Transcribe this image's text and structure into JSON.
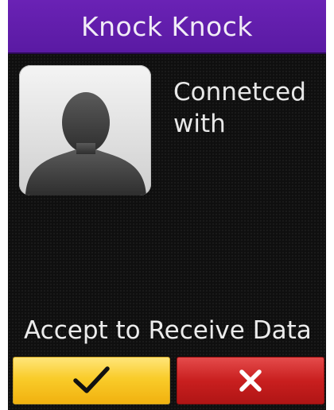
{
  "header": {
    "title": "Knock Knock"
  },
  "contact": {
    "status_line1": "Connetced",
    "status_line2": "with"
  },
  "prompt": {
    "text": "Accept to Receive Data"
  },
  "actions": {
    "accept_icon": "checkmark-icon",
    "reject_icon": "close-icon"
  },
  "colors": {
    "titlebar": "#5a1aa3",
    "accept": "#f9cc2a",
    "reject": "#c91f1f",
    "background": "#0f0f0f"
  }
}
